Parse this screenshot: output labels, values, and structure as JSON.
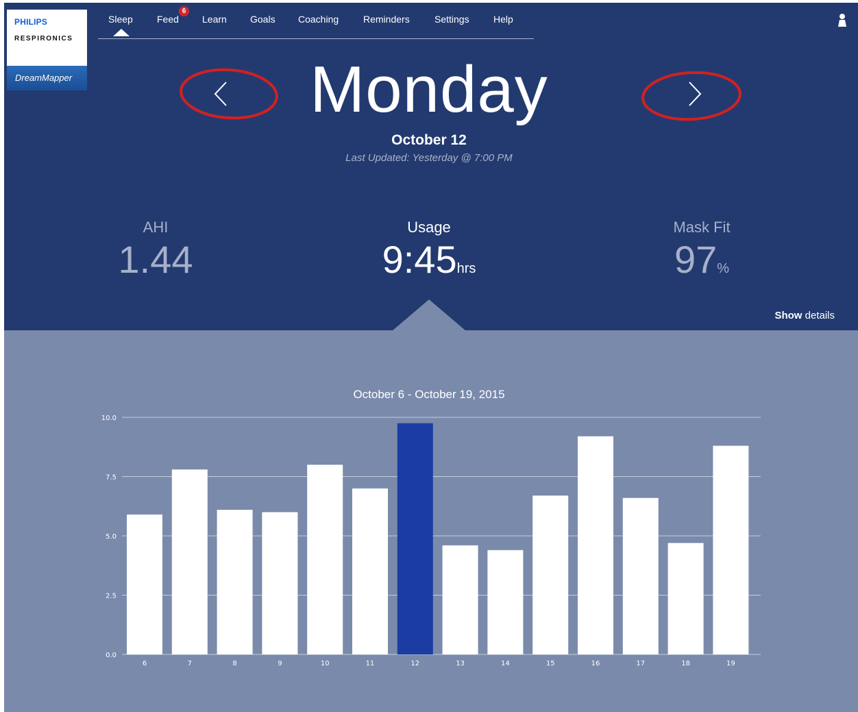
{
  "brand": {
    "company": "PHILIPS",
    "division": "RESPIRONICS",
    "app": "DreamMapper"
  },
  "nav": {
    "items": [
      {
        "label": "Sleep",
        "active": true
      },
      {
        "label": "Feed",
        "badge": "6"
      },
      {
        "label": "Learn"
      },
      {
        "label": "Goals"
      },
      {
        "label": "Coaching"
      },
      {
        "label": "Reminders"
      },
      {
        "label": "Settings"
      },
      {
        "label": "Help"
      }
    ]
  },
  "header": {
    "day": "Monday",
    "date": "October 12",
    "last_updated": "Last Updated: Yesterday @ 7:00 PM",
    "prev_icon": "chevron-left-icon",
    "next_icon": "chevron-right-icon"
  },
  "metrics": {
    "ahi": {
      "label": "AHI",
      "value": "1.44"
    },
    "usage": {
      "label": "Usage",
      "value": "9:45",
      "unit": "hrs"
    },
    "mask_fit": {
      "label": "Mask Fit",
      "value": "97",
      "unit": "%"
    }
  },
  "show_details": {
    "bold": "Show",
    "rest": "details"
  },
  "colors": {
    "header_bg": "#233a70",
    "chart_bg": "#7a8aab",
    "bar": "#ffffff",
    "bar_selected": "#1b3da3",
    "annotation": "#d42020",
    "badge": "#d6262a"
  },
  "chart_data": {
    "type": "bar",
    "title": "October 6 - October 19, 2015",
    "categories": [
      "6",
      "7",
      "8",
      "9",
      "10",
      "11",
      "12",
      "13",
      "14",
      "15",
      "16",
      "17",
      "18",
      "19"
    ],
    "values": [
      5.9,
      7.8,
      6.1,
      6.0,
      8.0,
      7.0,
      9.75,
      4.6,
      4.4,
      6.7,
      9.2,
      6.6,
      4.7,
      8.8
    ],
    "selected_category": "12",
    "ylim": [
      0,
      10
    ],
    "yticks": [
      "0.0",
      "2.5",
      "5.0",
      "7.5",
      "10.0"
    ],
    "ytick_values": [
      0,
      2.5,
      5,
      7.5,
      10
    ],
    "grid": true
  }
}
